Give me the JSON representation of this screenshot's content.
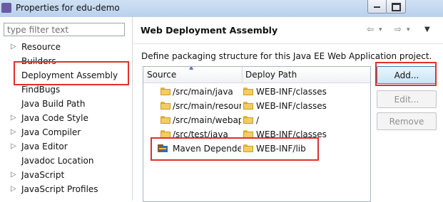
{
  "window": {
    "title": "Properties for edu-demo"
  },
  "filter": {
    "placeholder": "type filter text"
  },
  "tree": {
    "items": [
      {
        "label": "Resource",
        "arrow": "▷"
      },
      {
        "label": "Builders",
        "arrow": ""
      },
      {
        "label": "Deployment Assembly",
        "arrow": ""
      },
      {
        "label": "FindBugs",
        "arrow": ""
      },
      {
        "label": "Java Build Path",
        "arrow": ""
      },
      {
        "label": "Java Code Style",
        "arrow": "▷"
      },
      {
        "label": "Java Compiler",
        "arrow": "▷"
      },
      {
        "label": "Java Editor",
        "arrow": "▷"
      },
      {
        "label": "Javadoc Location",
        "arrow": ""
      },
      {
        "label": "JavaScript",
        "arrow": "▷"
      },
      {
        "label": "JavaScript Profiles",
        "arrow": "▷"
      }
    ]
  },
  "page": {
    "title": "Web Deployment Assembly",
    "description": "Define packaging structure for this Java EE Web Application project.",
    "nav": {
      "back": "⇦",
      "back_menu": "▾",
      "forward": "⇨",
      "forward_menu": "▾",
      "menu": "▼"
    }
  },
  "table": {
    "headers": {
      "source": "Source",
      "deploy": "Deploy Path"
    },
    "rows": [
      {
        "source": "/src/main/java",
        "deploy": "WEB-INF/classes",
        "icon": "folder"
      },
      {
        "source": "/src/main/resources",
        "deploy": "WEB-INF/classes",
        "icon": "folder"
      },
      {
        "source": "/src/main/webapp",
        "deploy": "/",
        "icon": "folder"
      },
      {
        "source": "/src/test/java",
        "deploy": "WEB-INF/classes",
        "icon": "folder"
      },
      {
        "source": "Maven Dependencies",
        "deploy": "WEB-INF/lib",
        "icon": "maven-library"
      }
    ]
  },
  "buttons": {
    "add": "Add...",
    "edit": "Edit...",
    "remove": "Remove"
  },
  "colors": {
    "highlight": "#e0302a",
    "titlebar": "#c5d9f1",
    "folder": "#f3cd62"
  }
}
